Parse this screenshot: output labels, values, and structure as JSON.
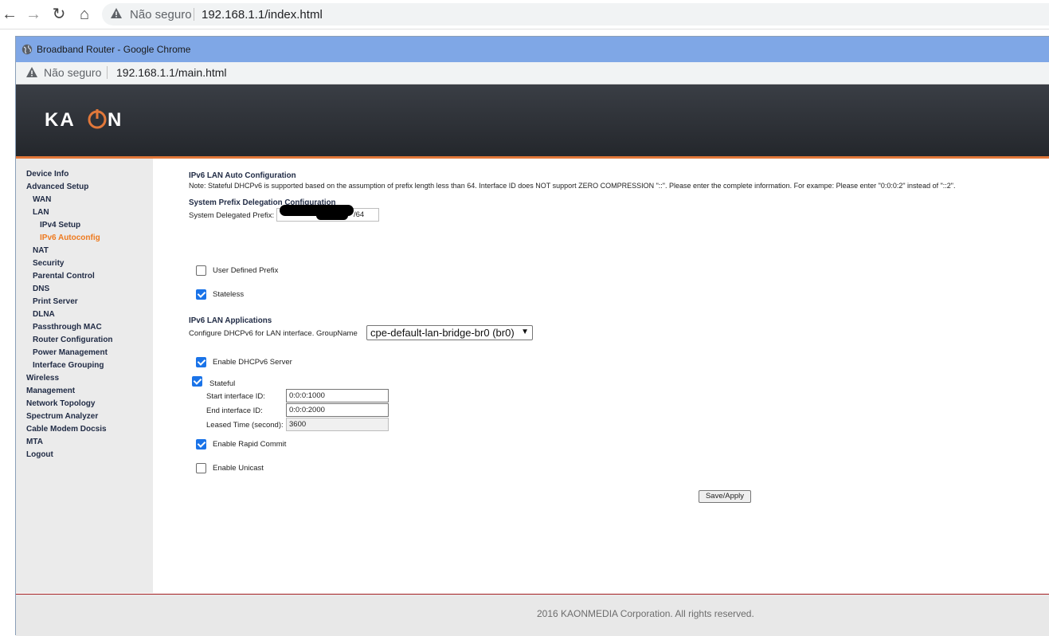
{
  "outer_browser": {
    "security_label": "Não seguro",
    "url": "192.168.1.1/index.html"
  },
  "popup": {
    "title": "Broadband Router - Google Chrome",
    "security_label": "Não seguro",
    "url": "192.168.1.1/main.html"
  },
  "header": {
    "logo_text": "KAON",
    "accent_color": "#e2783a"
  },
  "sidebar": {
    "items": [
      {
        "label": "Device Info"
      },
      {
        "label": "Advanced Setup"
      },
      {
        "label": "WAN"
      },
      {
        "label": "LAN"
      },
      {
        "label": "IPv4 Setup"
      },
      {
        "label": "IPv6 Autoconfig",
        "active": true
      },
      {
        "label": "NAT"
      },
      {
        "label": "Security"
      },
      {
        "label": "Parental Control"
      },
      {
        "label": "DNS"
      },
      {
        "label": "Print Server"
      },
      {
        "label": "DLNA"
      },
      {
        "label": "Passthrough MAC"
      },
      {
        "label": "Router Configuration"
      },
      {
        "label": "Power Management"
      },
      {
        "label": "Interface Grouping"
      },
      {
        "label": "Wireless"
      },
      {
        "label": "Management"
      },
      {
        "label": "Network Topology"
      },
      {
        "label": "Spectrum Analyzer"
      },
      {
        "label": "Cable Modem Docsis"
      },
      {
        "label": "MTA"
      },
      {
        "label": "Logout"
      }
    ]
  },
  "content": {
    "title": "IPv6 LAN Auto Configuration",
    "note": "Note: Stateful DHCPv6 is supported based on the assumption of prefix length less than 64. Interface ID does NOT support ZERO COMPRESSION \"::\". Please enter the complete information. For exampe: Please enter \"0:0:0:2\" instead of \"::2\".",
    "prefix_section": {
      "heading": "System Prefix Delegation Configuration",
      "delegated_prefix_label": "System Delegated Prefix:",
      "delegated_prefix_suffix": "/64",
      "user_defined_prefix_label": "User Defined Prefix",
      "user_defined_prefix_checked": false,
      "stateless_label": "Stateless",
      "stateless_checked": true
    },
    "lan_apps": {
      "heading": "IPv6 LAN Applications",
      "configure_label": "Configure DHCPv6 for LAN interface.  GroupName",
      "group_name": "cpe-default-lan-bridge-br0 (br0)",
      "enable_server_label": "Enable DHCPv6 Server",
      "enable_server_checked": true,
      "stateful_label": "Stateful",
      "stateful_checked": true,
      "start_id_label": "Start interface ID:",
      "start_id_value": "0:0:0:1000",
      "end_id_label": "End interface ID:",
      "end_id_value": "0:0:0:2000",
      "leased_time_label": "Leased Time (second):",
      "leased_time_value": "3600",
      "rapid_commit_label": "Enable Rapid Commit",
      "rapid_commit_checked": true,
      "unicast_label": "Enable Unicast",
      "unicast_checked": false
    },
    "save_button": "Save/Apply"
  },
  "footer": {
    "copyright": "2016 KAONMEDIA Corporation. All rights reserved."
  }
}
